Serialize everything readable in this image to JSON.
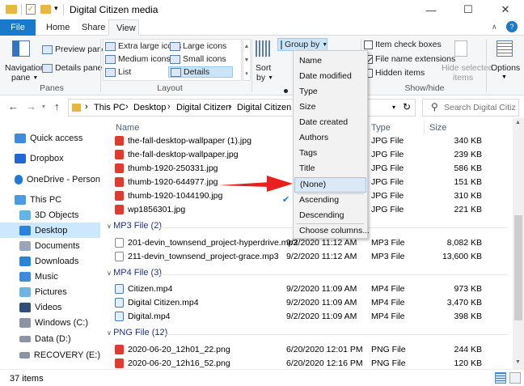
{
  "window": {
    "title": "Digital Citizen media",
    "minimize": "—",
    "maximize": "☐",
    "close": "✕"
  },
  "tabs": [
    {
      "label": "File"
    },
    {
      "label": "Home"
    },
    {
      "label": "Share"
    },
    {
      "label": "View"
    }
  ],
  "ribbon": {
    "panes": {
      "navigation": "Navigation",
      "navigation2": "pane",
      "preview": "Preview pane",
      "details": "Details pane",
      "label": "Panes"
    },
    "layout": {
      "extra_large": "Extra large icons",
      "large": "Large icons",
      "medium": "Medium icons",
      "small": "Small icons",
      "list": "List",
      "details": "Details",
      "label": "Layout"
    },
    "sort": {
      "label": "Sort",
      "label2": "by"
    },
    "group_by": "Group by",
    "showhide": {
      "item_check": "Item check boxes",
      "file_ext": "File name extensions",
      "hidden": "Hidden items",
      "hide_sel": "Hide selected",
      "hide_sel2": "items",
      "label": "Show/hide"
    },
    "options": "Options"
  },
  "address": {
    "crumbs": [
      "This PC",
      "Desktop",
      "Digital Citizen",
      "Digital Citizen"
    ],
    "search_placeholder": "Search Digital Citiz..."
  },
  "nav": [
    {
      "label": "Quick access"
    },
    {
      "label": "Dropbox"
    },
    {
      "label": "OneDrive - Person"
    },
    {
      "label": "This PC"
    },
    {
      "label": "3D Objects"
    },
    {
      "label": "Desktop"
    },
    {
      "label": "Documents"
    },
    {
      "label": "Downloads"
    },
    {
      "label": "Music"
    },
    {
      "label": "Pictures"
    },
    {
      "label": "Videos"
    },
    {
      "label": "Windows (C:)"
    },
    {
      "label": "Data (D:)"
    },
    {
      "label": "RECOVERY (E:)"
    }
  ],
  "columns": {
    "name": "Name",
    "type": "Type",
    "size": "Size"
  },
  "groups": {
    "mp3": "MP3 File (2)",
    "mp4": "MP4 File (3)",
    "png": "PNG File (12)"
  },
  "files": [
    {
      "name": "the-fall-desktop-wallpaper (1).jpg",
      "type": "JPG File",
      "size": "340 KB"
    },
    {
      "name": "the-fall-desktop-wallpaper.jpg",
      "type": "JPG File",
      "size": "239 KB"
    },
    {
      "name": "thumb-1920-250331.jpg",
      "type": "JPG File",
      "size": "586 KB"
    },
    {
      "name": "thumb-1920-644977.jpg",
      "type": "JPG File",
      "size": "151 KB"
    },
    {
      "name": "thumb-1920-1044190.jpg",
      "type": "JPG File",
      "size": "310 KB"
    },
    {
      "name": "wp1856301.jpg",
      "type": "JPG File",
      "size": "221 KB"
    },
    {
      "name": "201-devin_townsend_project-hyperdrive.mp3",
      "date": "9/2/2020 11:12 AM",
      "type": "MP3 File",
      "size": "8,082 KB"
    },
    {
      "name": "211-devin_townsend_project-grace.mp3",
      "date": "9/2/2020 11:12 AM",
      "type": "MP3 File",
      "size": "13,600 KB"
    },
    {
      "name": "Citizen.mp4",
      "date": "9/2/2020 11:09 AM",
      "type": "MP4 File",
      "size": "973 KB"
    },
    {
      "name": "Digital Citizen.mp4",
      "date": "9/2/2020 11:09 AM",
      "type": "MP4 File",
      "size": "3,470 KB"
    },
    {
      "name": "Digital.mp4",
      "date": "9/2/2020 11:09 AM",
      "type": "MP4 File",
      "size": "398 KB"
    },
    {
      "name": "2020-06-20_12h01_22.png",
      "date": "6/20/2020 12:01 PM",
      "type": "PNG File",
      "size": "244 KB"
    },
    {
      "name": "2020-06-20_12h16_52.png",
      "date": "6/20/2020 12:16 PM",
      "type": "PNG File",
      "size": "120 KB"
    }
  ],
  "menu": [
    {
      "label": "Name"
    },
    {
      "label": "Date modified"
    },
    {
      "label": "Type"
    },
    {
      "label": "Size"
    },
    {
      "label": "Date created"
    },
    {
      "label": "Authors"
    },
    {
      "label": "Tags"
    },
    {
      "label": "Title"
    },
    {
      "label": "(None)"
    },
    {
      "label": "Ascending"
    },
    {
      "label": "Descending"
    },
    {
      "label": "Choose columns..."
    }
  ],
  "status": {
    "count": "37 items"
  },
  "colors": {
    "accent": "#1979ca",
    "arrow": "#e8211e",
    "group_text": "#1e3287"
  }
}
